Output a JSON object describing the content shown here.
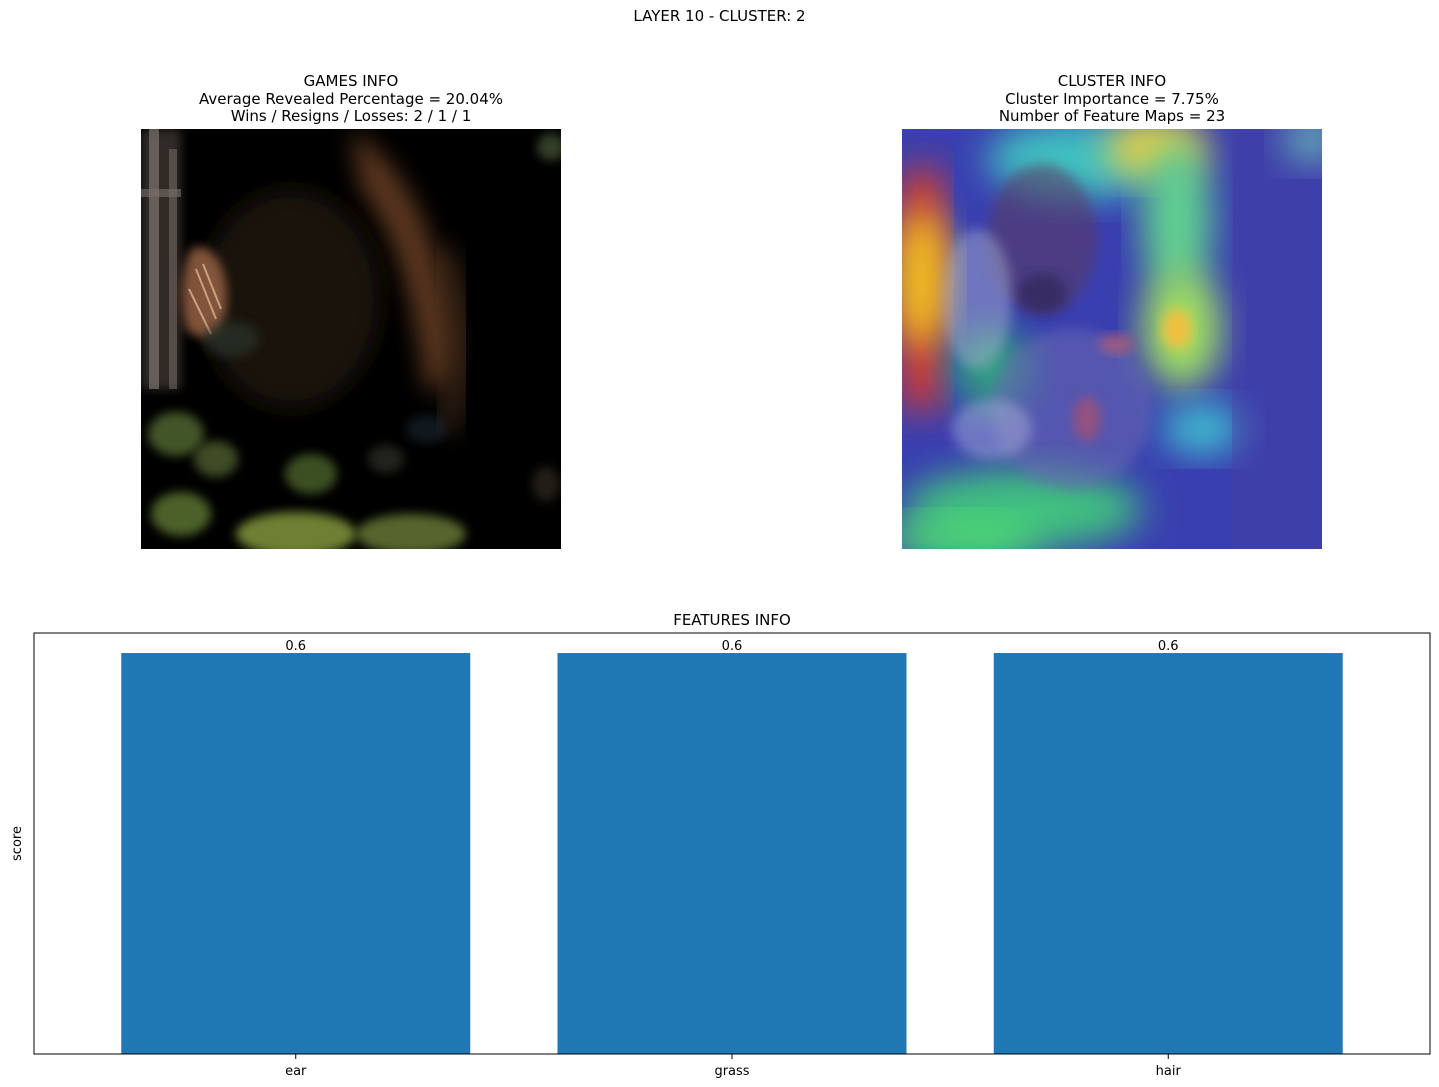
{
  "figure": {
    "suptitle": "LAYER 10 - CLUSTER: 2"
  },
  "games_panel": {
    "title_line1": "GAMES INFO",
    "title_line2": "Average Revealed Percentage = 20.04%",
    "title_line3": "Wins / Resigns / Losses: 2 / 1 / 1",
    "image_description_icon": "masked-dog-photo-icon"
  },
  "cluster_panel": {
    "title_line1": "CLUSTER INFO",
    "title_line2": "Cluster Importance = 7.75%",
    "title_line3": "Number of Feature Maps = 23",
    "image_description_icon": "heatmap-overlay-dog-photo-icon"
  },
  "chart_data": {
    "type": "bar",
    "title": "FEATURES INFO",
    "xlabel": "",
    "ylabel": "score",
    "categories": [
      "ear",
      "grass",
      "hair"
    ],
    "values": [
      0.6,
      0.6,
      0.6
    ],
    "data_labels": [
      "0.6",
      "0.6",
      "0.6"
    ],
    "ylim": [
      0,
      0.63
    ],
    "y_ticks_visible": false,
    "grid": false,
    "bar_color": "#1f77b4"
  }
}
